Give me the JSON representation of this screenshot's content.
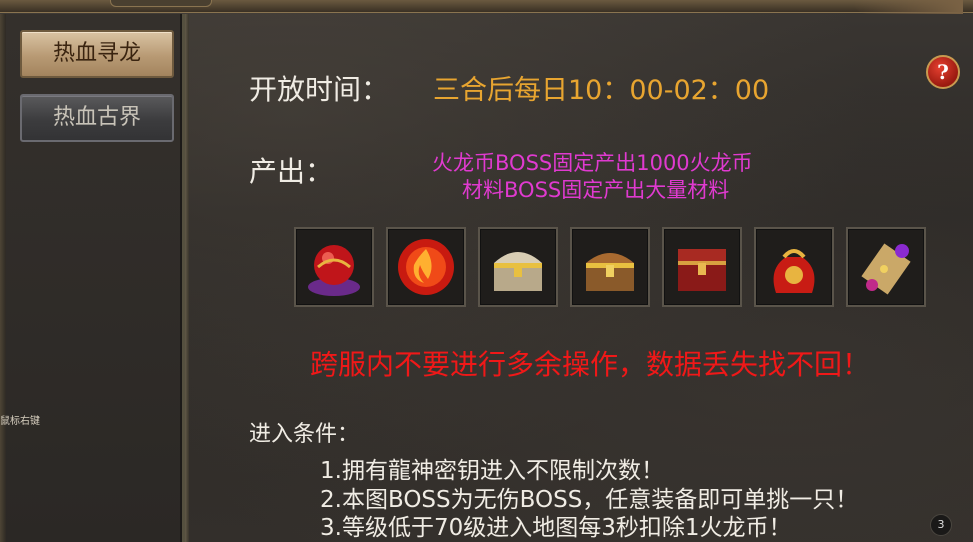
{
  "sidebar": {
    "tabs": [
      {
        "label": "热血寻龙",
        "active": true
      },
      {
        "label": "热血古界",
        "active": false
      }
    ],
    "side_note": "鼠标右键"
  },
  "help_label": "?",
  "open_time": {
    "label": "开放时间：",
    "value": "三合后每日10：00-02：00"
  },
  "output": {
    "label": "产出：",
    "lines": [
      "火龙币BOSS固定产出1000火龙币",
      "材料BOSS固定产出大量材料"
    ]
  },
  "items": [
    {
      "icon": "red-orb-on-cushion-icon"
    },
    {
      "icon": "flame-orb-icon"
    },
    {
      "icon": "silver-treasure-chest-icon"
    },
    {
      "icon": "gold-treasure-chest-icon"
    },
    {
      "icon": "red-treasure-chest-icon"
    },
    {
      "icon": "red-treasure-bag-icon"
    },
    {
      "icon": "magic-scroll-icon"
    }
  ],
  "warning": "跨服内不要进行多余操作，数据丢失找不回！",
  "conditions": {
    "title": "进入条件：",
    "items": [
      "1.拥有龍神密钥进入不限制次数！",
      "2.本图BOSS为无伤BOSS，任意装备即可单挑一只！",
      "3.等级低于70级进入地图每3秒扣除1火龙币！"
    ]
  },
  "page_badge": "3",
  "colors": {
    "time_value": "#e8a530",
    "output_text": "#e03ad0",
    "warning": "#f01818",
    "label": "#f0ece4"
  }
}
